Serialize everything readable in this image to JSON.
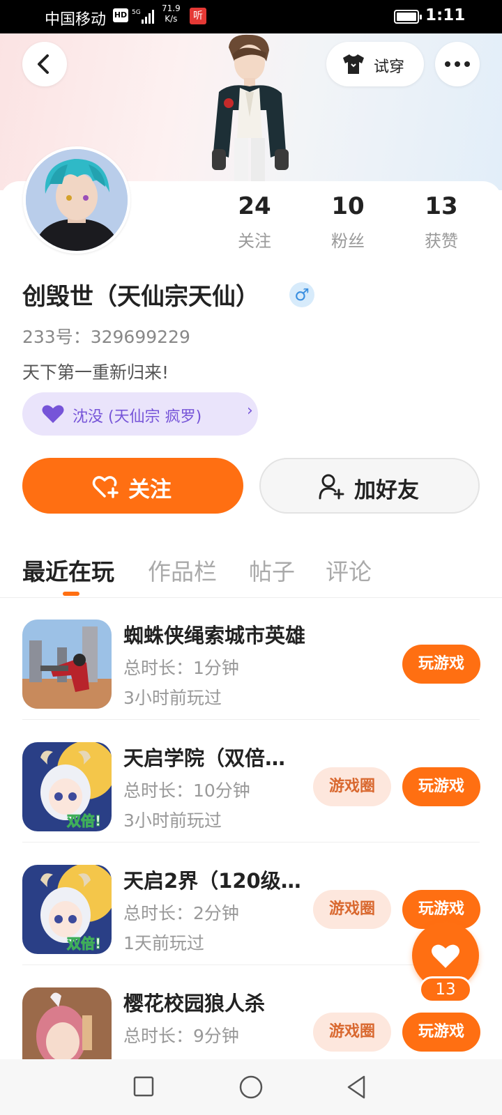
{
  "status_bar": {
    "carrier": "中国移动",
    "hd": "HD",
    "speed_value": "71.9",
    "speed_unit": "K/s",
    "app_badge": "听",
    "time": "1:11"
  },
  "header": {
    "tryon_label": "试穿"
  },
  "profile": {
    "stats": [
      {
        "value": "24",
        "label": "关注"
      },
      {
        "value": "10",
        "label": "粉丝"
      },
      {
        "value": "13",
        "label": "获赞"
      }
    ],
    "name": "创毁世（天仙宗天仙）",
    "gender_symbol": "♂",
    "uid": "233号：329699229",
    "bio": "天下第一重新归来!",
    "cp_tag": "沈没 (天仙宗 疯罗)",
    "cp_chevron": "›"
  },
  "actions": {
    "follow_label": "关注",
    "add_friend_label": "加好友"
  },
  "tabs": [
    {
      "label": "最近在玩",
      "active": true
    },
    {
      "label": "作品栏",
      "active": false
    },
    {
      "label": "帖子",
      "active": false
    },
    {
      "label": "评论",
      "active": false
    }
  ],
  "games": [
    {
      "title": "蜘蛛侠绳索城市英雄",
      "duration": "总时长：1分钟",
      "last_played": "3小时前玩过",
      "circle_label": null,
      "play_label": "玩游戏",
      "icon_badge": null
    },
    {
      "title": "天启学院（双倍…",
      "duration": "总时长：10分钟",
      "last_played": "3小时前玩过",
      "circle_label": "游戏圈",
      "play_label": "玩游戏",
      "icon_badge": "双倍!"
    },
    {
      "title": "天启2界（120级…",
      "duration": "总时长：2分钟",
      "last_played": "1天前玩过",
      "circle_label": "游戏圈",
      "play_label": "玩游戏",
      "icon_badge": "双倍!"
    },
    {
      "title": "樱花校园狼人杀",
      "duration": "总时长：9分钟",
      "last_played": "",
      "circle_label": "游戏圈",
      "play_label": "玩游戏",
      "icon_badge": null
    }
  ],
  "like_fab": {
    "count": "13"
  },
  "colors": {
    "accent": "#ff6f12",
    "cp_tag_bg": "#eae4fb",
    "cp_tag_text": "#7654d8",
    "circle_pill_bg": "#fde7dd"
  }
}
